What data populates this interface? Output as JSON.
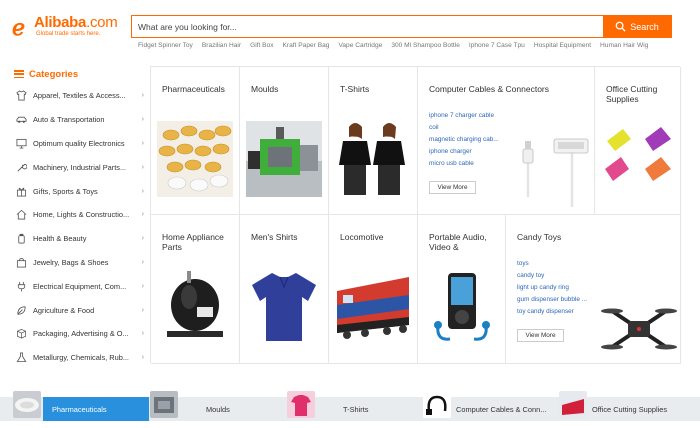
{
  "header": {
    "logo_text": "Alibaba",
    "logo_dotcom": ".com",
    "logo_tagline": "Global trade starts here.",
    "search_placeholder": "What are you looking for...",
    "search_button": "Search",
    "keywords": [
      "Fidget Spinner Toy",
      "Brazilian Hair",
      "Gift Box",
      "Kraft Paper Bag",
      "Vape Cartridge",
      "300 Ml Shampoo Bottle",
      "Iphone 7 Case Tpu",
      "Hospital Equipment",
      "Human Hair Wig"
    ]
  },
  "sidebar": {
    "title": "Categories",
    "items": [
      {
        "label": "Apparel, Textiles & Access...",
        "icon": "shirt-icon"
      },
      {
        "label": "Auto & Transportation",
        "icon": "car-icon"
      },
      {
        "label": "Optimum quality Electronics",
        "icon": "monitor-icon"
      },
      {
        "label": "Machinery, Industrial Parts...",
        "icon": "wrench-icon"
      },
      {
        "label": "Gifts, Sports & Toys",
        "icon": "gift-icon"
      },
      {
        "label": "Home, Lights & Constructio...",
        "icon": "home-icon"
      },
      {
        "label": "Health & Beauty",
        "icon": "bottle-icon"
      },
      {
        "label": "Jewelry, Bags & Shoes",
        "icon": "bag-icon"
      },
      {
        "label": "Electrical Equipment, Com...",
        "icon": "plug-icon"
      },
      {
        "label": "Agriculture & Food",
        "icon": "leaf-icon"
      },
      {
        "label": "Packaging, Advertising & O...",
        "icon": "box-icon"
      },
      {
        "label": "Metallurgy, Chemicals, Rub...",
        "icon": "flask-icon"
      }
    ]
  },
  "tiles": {
    "pharmaceuticals": "Pharmaceuticals",
    "moulds": "Moulds",
    "tshirts": "T-Shirts",
    "cables": {
      "title": "Computer Cables & Connectors",
      "links": [
        "iphone 7 charger cable",
        "coil",
        "magnetic charging cab...",
        "iphone charger",
        "micro usb cable"
      ],
      "view_more": "View More"
    },
    "office": "Office Cutting Supplies",
    "home_appliance": "Home Appliance Parts",
    "mens_shirts": "Men's Shirts",
    "locomotive": "Locomotive",
    "audio": "Portable Audio, Video &",
    "candy": {
      "title": "Candy Toys",
      "links": [
        "toys",
        "candy toy",
        "light up candy ring",
        "gum dispenser bubble ...",
        "toy candy dispenser"
      ],
      "view_more": "View More"
    }
  },
  "bottom_tabs": [
    {
      "label": "Pharmaceuticals",
      "active": true
    },
    {
      "label": "Moulds",
      "active": false
    },
    {
      "label": "T-Shirts",
      "active": false
    },
    {
      "label": "Computer Cables & Conn...",
      "active": false
    },
    {
      "label": "Office Cutting Supplies",
      "active": false
    }
  ],
  "colors": {
    "brand": "#ff6a00",
    "link": "#2d67b6",
    "active_tab": "#2990de"
  }
}
